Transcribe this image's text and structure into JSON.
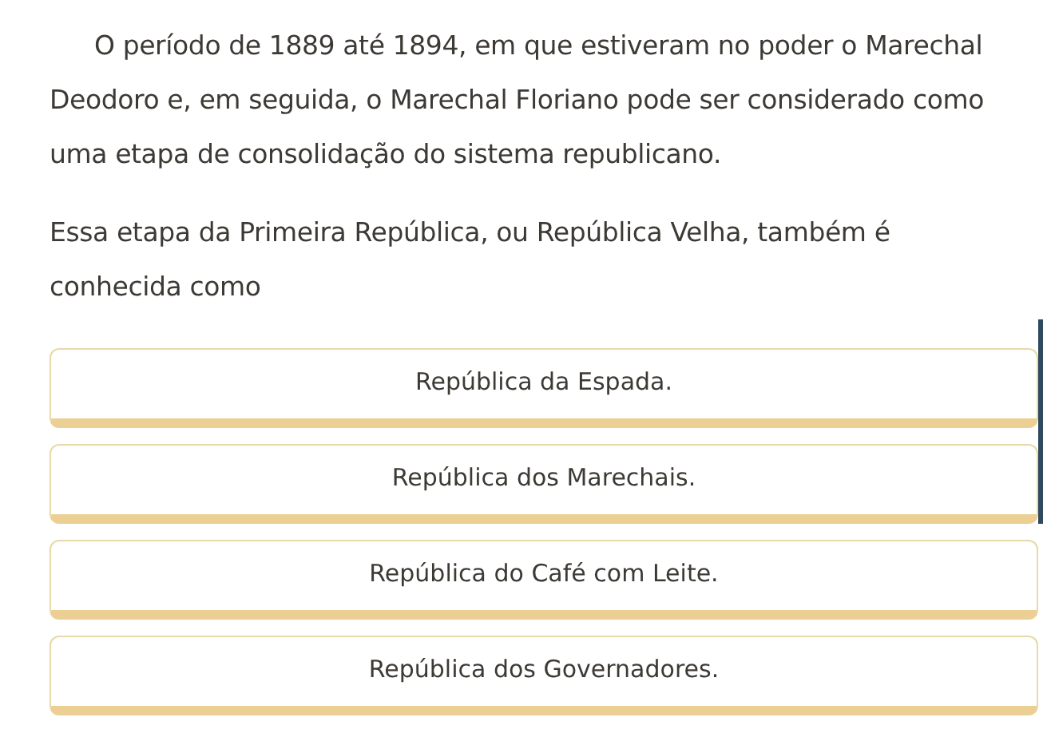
{
  "question": {
    "paragraphs": [
      "O período de 1889 até 1894, em que estiveram no poder o Marechal Deodoro e, em seguida, o Marechal Floriano pode ser considerado como uma etapa de consolidação do sistema republicano.",
      "Essa etapa da Primeira República, ou República Velha, também é conhecida como"
    ]
  },
  "options": [
    {
      "label": "República da Espada."
    },
    {
      "label": "República dos Marechais."
    },
    {
      "label": "República do Café com Leite."
    },
    {
      "label": "República dos Governadores."
    }
  ]
}
